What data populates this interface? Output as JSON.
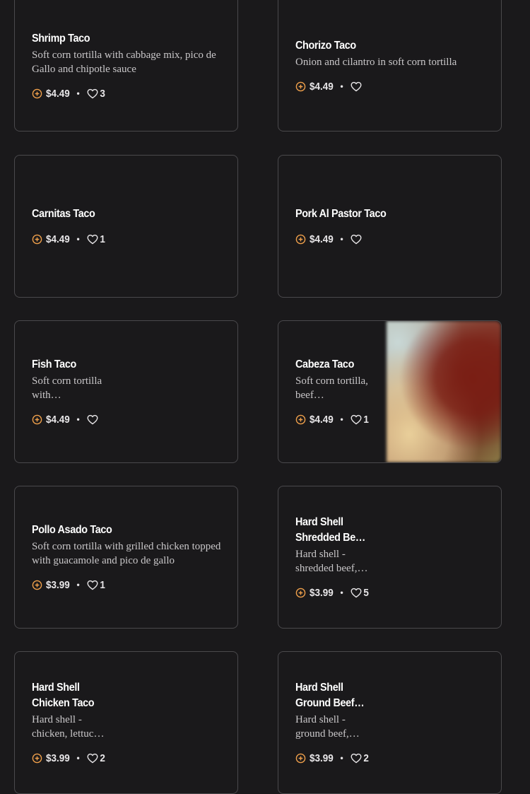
{
  "colors": {
    "background": "#1a191b",
    "border": "#4a494c",
    "accent": "#f0a04b"
  },
  "icons": {
    "add": "plus-circle-icon",
    "like": "heart-outline-icon"
  },
  "items": [
    {
      "name": "Shrimp Taco",
      "description": "Soft corn tortilla with cabbage mix, pico de Gallo and chipotle sauce",
      "price": "$4.49",
      "separator": "•",
      "likes": "3"
    },
    {
      "name": "Chorizo Taco",
      "description": "Onion and cilantro in soft corn tortilla",
      "price": "$4.49",
      "separator": "•",
      "likes": ""
    },
    {
      "name": "Carnitas Taco",
      "description": "",
      "price": "$4.49",
      "separator": "•",
      "likes": "1"
    },
    {
      "name": "Pork Al Pastor Taco",
      "description": "",
      "price": "$4.49",
      "separator": "•",
      "likes": ""
    },
    {
      "name": "Fish Taco",
      "description": "Soft corn tortilla with…",
      "price": "$4.49",
      "separator": "•",
      "likes": ""
    },
    {
      "name": "Cabeza Taco",
      "description": "Soft corn tortilla, beef…",
      "price": "$4.49",
      "separator": "•",
      "likes": "1"
    },
    {
      "name": "Pollo Asado Taco",
      "description": "Soft corn tortilla with grilled chicken topped with guacamole and pico de gallo",
      "price": "$3.99",
      "separator": "•",
      "likes": "1"
    },
    {
      "name": "Hard Shell Shredded Be…",
      "description": "Hard shell - shredded beef,…",
      "price": "$3.99",
      "separator": "•",
      "likes": "5"
    },
    {
      "name": "Hard Shell Chicken Taco",
      "description": "Hard shell - chicken, lettuc…",
      "price": "$3.99",
      "separator": "•",
      "likes": "2"
    },
    {
      "name": "Hard Shell Ground Beef…",
      "description": "Hard shell - ground beef,…",
      "price": "$3.99",
      "separator": "•",
      "likes": "2"
    }
  ]
}
